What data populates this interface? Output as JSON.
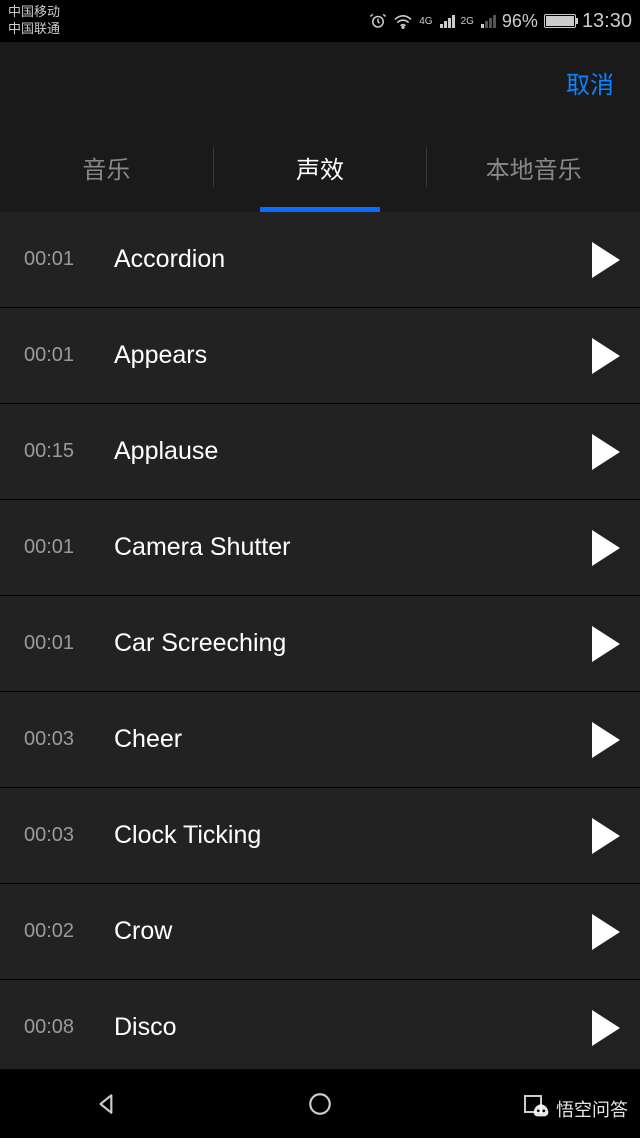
{
  "status": {
    "carrier1": "中国移动",
    "carrier2": "中国联通",
    "signal1_label": "4G",
    "signal2_label": "2G",
    "battery_pct": "96%",
    "time": "13:30"
  },
  "header": {
    "cancel": "取消"
  },
  "tabs": [
    {
      "label": "音乐",
      "active": false
    },
    {
      "label": "声效",
      "active": true
    },
    {
      "label": "本地音乐",
      "active": false
    }
  ],
  "items": [
    {
      "duration": "00:01",
      "title": "Accordion"
    },
    {
      "duration": "00:01",
      "title": "Appears"
    },
    {
      "duration": "00:15",
      "title": "Applause"
    },
    {
      "duration": "00:01",
      "title": "Camera Shutter"
    },
    {
      "duration": "00:01",
      "title": "Car Screeching"
    },
    {
      "duration": "00:03",
      "title": "Cheer"
    },
    {
      "duration": "00:03",
      "title": "Clock Ticking"
    },
    {
      "duration": "00:02",
      "title": "Crow"
    },
    {
      "duration": "00:08",
      "title": "Disco"
    }
  ],
  "watermark": "悟空问答"
}
